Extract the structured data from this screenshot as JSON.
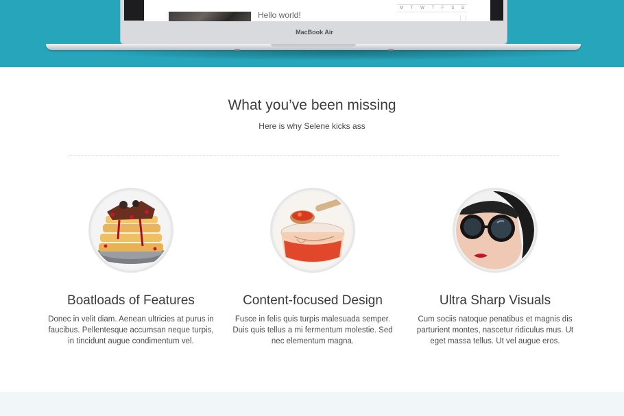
{
  "hero": {
    "screen_post_title": "Hello world!",
    "calendar_days": [
      "M",
      "T",
      "W",
      "T",
      "F",
      "S",
      "S"
    ],
    "laptop_brand": "MacBook Air",
    "background_color": "#27a6bb"
  },
  "section": {
    "title": "What you’ve been missing",
    "subtitle": "Here is why Selene kicks ass"
  },
  "features": [
    {
      "image": "waffles-dessert-photo",
      "title": "Boatloads of Features",
      "text": "Donec in velit diam. Aenean ultricies at purus in faucibus. Pellentesque accumsan neque turpis, in tincidunt augue condimentum vel."
    },
    {
      "image": "jam-jar-spoon-photo",
      "title": "Content-focused Design",
      "text": "Fusce in felis quis turpis malesuada semper. Duis quis tellus a mi fermentum molestie. Sed nec elementum magna."
    },
    {
      "image": "woman-sunglasses-photo",
      "title": "Ultra Sharp Visuals",
      "text": "Cum sociis natoque penatibus et magnis dis parturient montes, nascetur ridiculus mus. Ut eget massa tellus. Ut vel augue eros."
    }
  ]
}
